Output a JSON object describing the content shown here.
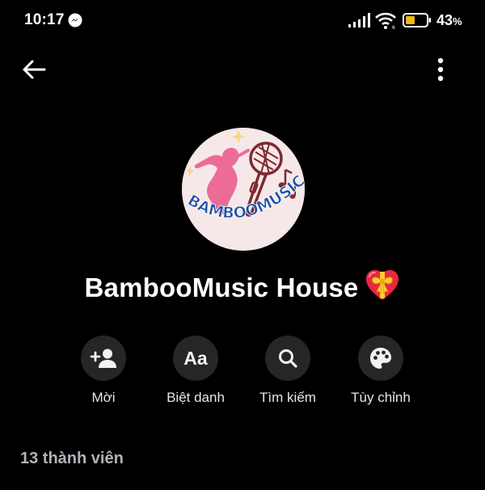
{
  "status_bar": {
    "time": "10:17",
    "battery_percent": "43",
    "battery_unit": "%",
    "icons": [
      "messenger-icon",
      "signal-icon",
      "wifi-icon",
      "battery-icon"
    ]
  },
  "header": {
    "back_icon": "arrow-left-icon",
    "menu_icon": "more-vertical-icon"
  },
  "group": {
    "name": "BambooMusic House",
    "emoji": "heart-with-ribbon",
    "avatar_logo_text": "BAMBOOMUSIC"
  },
  "actions": [
    {
      "label": "Mời",
      "icon": "add-person-icon"
    },
    {
      "label": "Biệt danh",
      "icon": "text-aa-icon",
      "icon_text": "Aa"
    },
    {
      "label": "Tìm kiếm",
      "icon": "search-icon"
    },
    {
      "label": "Tùy chỉnh",
      "icon": "palette-icon"
    }
  ],
  "members": {
    "label": "13 thành viên"
  },
  "colors": {
    "background": "#000000",
    "button_bg": "#262626",
    "secondary_text": "#b0b3b8",
    "battery_fill": "#f2b61a"
  }
}
